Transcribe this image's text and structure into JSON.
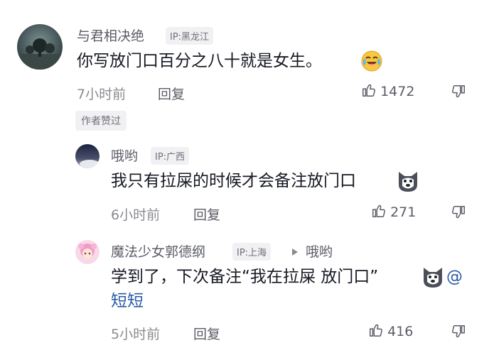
{
  "comments": [
    {
      "username": "与君相决绝",
      "ip": "IP:黑龙江",
      "text": "你写放门口百分之八十就是女生。",
      "time": "7小时前",
      "reply": "回复",
      "likes": "1472",
      "author_tag": "作者赞过",
      "emoji": "crying-laughing-emoji"
    },
    {
      "username": "哦哟",
      "ip": "IP:广西",
      "text": "我只有拉屎的时候才会备注放门口",
      "time": "6小时前",
      "reply": "回复",
      "likes": "271",
      "emoji": "husky-dog-emoji"
    },
    {
      "username": "魔法少女郭德纲",
      "ip": "IP:上海",
      "reply_to": "哦哟",
      "text_line1": "学到了，下次备注“我在拉屎 放门口”",
      "mention_at": "@",
      "mention_name": "短短",
      "time": "5小时前",
      "reply": "回复",
      "likes": "416",
      "emoji": "husky-dog-emoji"
    }
  ],
  "colors": {
    "link": "#2b5aa6",
    "text": "#161823",
    "secondary": "#8a8b91"
  },
  "icons": [
    "thumb-up-icon",
    "thumb-down-icon",
    "reply-arrow-icon"
  ]
}
